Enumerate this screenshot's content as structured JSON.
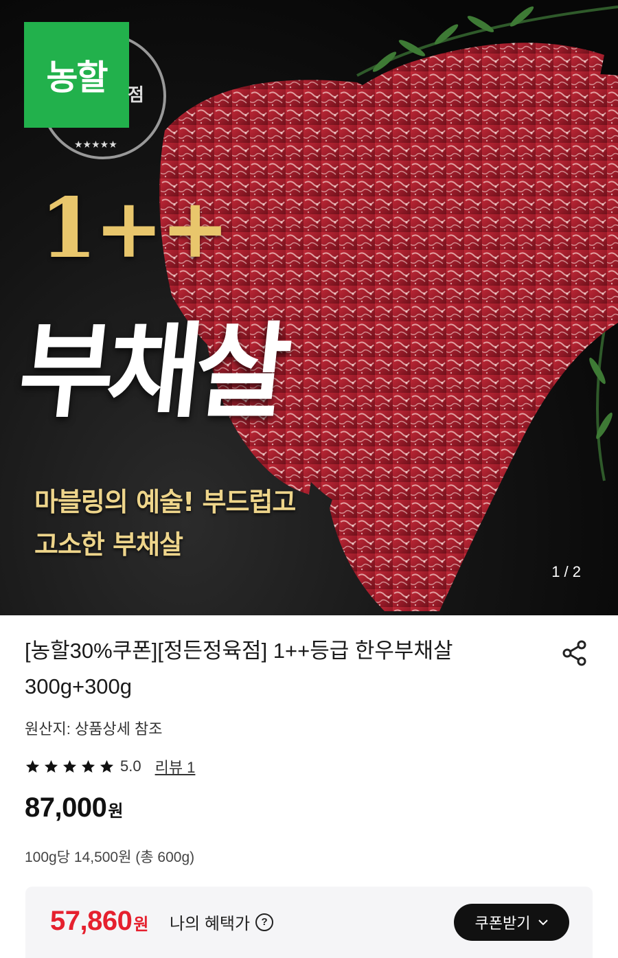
{
  "hero": {
    "badge_text": "농할",
    "seal_text": "점",
    "grade_text": "1++",
    "cut_name": "부채살",
    "tagline_line1": "마블링의 예술! 부드럽고",
    "tagline_line2": "고소한 부채살",
    "page_indicator": "1 / 2",
    "colors": {
      "badge": "#22b14c",
      "grade_gold": "#e8c66c",
      "tagline": "#eed58b",
      "meat": "#a8202e"
    }
  },
  "product": {
    "title": "[농할30%쿠폰][정든정육점] 1++등급 한우부채살 300g+300g",
    "share_icon": "share-icon",
    "origin": "원산지: 상품상세 참조",
    "rating": {
      "stars": 5,
      "score": "5.0",
      "review_link": "리뷰 1"
    },
    "price": {
      "amount": "87,000",
      "currency": "원"
    },
    "unit_price": "100g당 14,500원 (총 600g)"
  },
  "benefit": {
    "amount": "57,860",
    "currency": "원",
    "label": "나의 혜택가",
    "help_icon_glyph": "?",
    "coupon_button_label": "쿠폰받기",
    "accent_color": "#e5202e"
  }
}
